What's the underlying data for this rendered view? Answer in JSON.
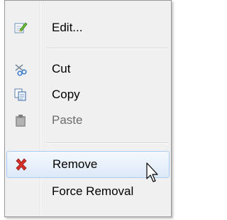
{
  "menu": {
    "items": [
      {
        "label": "Edit...",
        "icon": "edit-note-icon",
        "enabled": true
      },
      {
        "label": "Cut",
        "icon": "scissors-icon",
        "enabled": true
      },
      {
        "label": "Copy",
        "icon": "copy-icon",
        "enabled": true
      },
      {
        "label": "Paste",
        "icon": "clipboard-icon",
        "enabled": false
      },
      {
        "label": "Remove",
        "icon": "red-x-icon",
        "enabled": true,
        "hovered": true
      },
      {
        "label": "Force Removal",
        "icon": "",
        "enabled": true
      }
    ]
  },
  "colors": {
    "menu_bg": "#f0f0f0",
    "hover_border": "#a8cbf1",
    "remove_icon": "#d9302b",
    "disabled_text": "#6d6d6d"
  }
}
